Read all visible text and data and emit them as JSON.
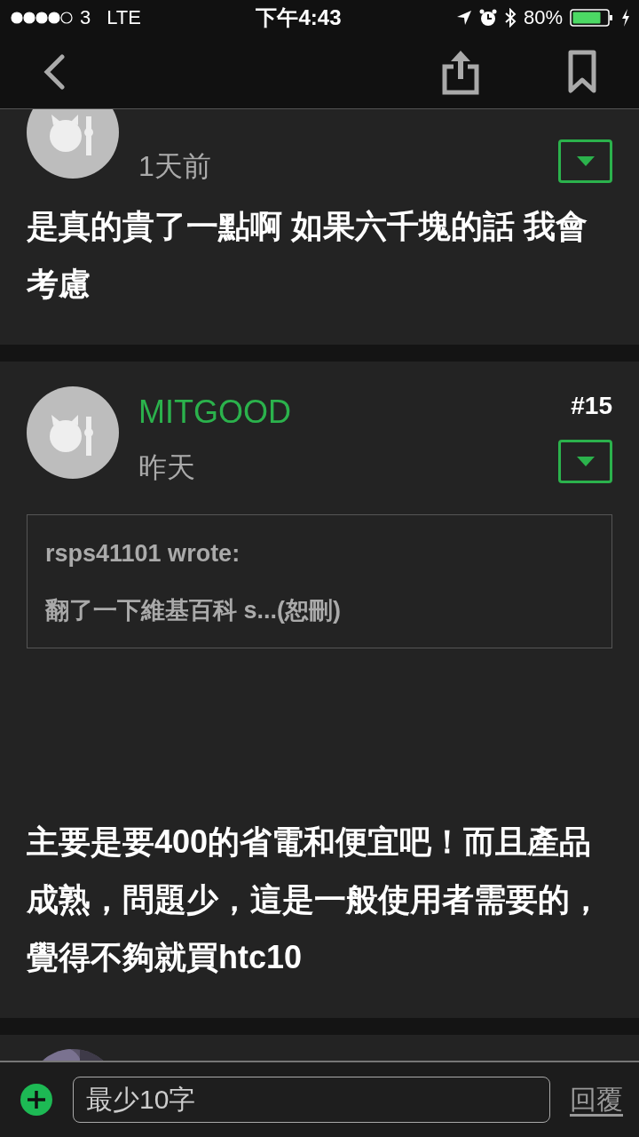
{
  "status_bar": {
    "carrier": "3",
    "network": "LTE",
    "time": "下午4:43",
    "battery": "80%"
  },
  "posts": [
    {
      "time": "1天前",
      "body": "是真的貴了一點啊 如果六千塊的話 我會考慮"
    },
    {
      "username": "MITGOOD",
      "floor": "#15",
      "time": "昨天",
      "quote": {
        "author": "rsps41101 wrote:",
        "text": "翻了一下維基百科 s...(恕刪)"
      },
      "body": "主要是要400的省電和便宜吧！而且產品成熟，問題少，這是一般使用者需要的，覺得不夠就買htc10"
    }
  ],
  "reply_bar": {
    "placeholder": "最少10字",
    "submit": "回覆"
  }
}
